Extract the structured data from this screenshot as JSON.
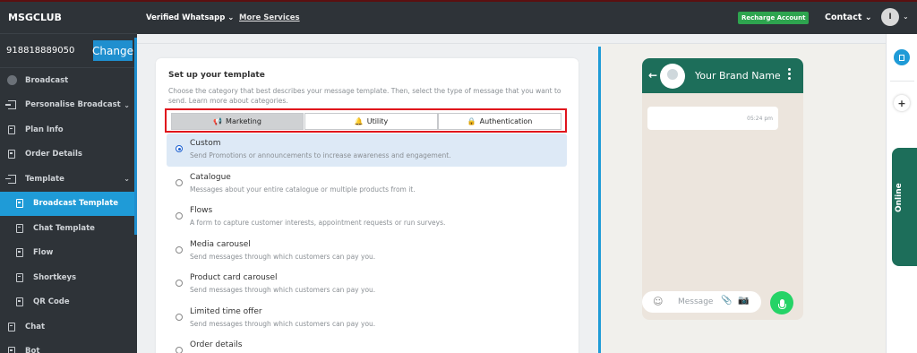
{
  "brand": "MSGCLUB",
  "phone_number": "918818889050",
  "change_label": "Change",
  "sidebar": {
    "items": [
      {
        "label": "Broadcast",
        "icon": "broadcast-icon"
      },
      {
        "label": "Personalise Broadcast",
        "icon": "login-icon",
        "chevron": true
      },
      {
        "label": "Plan Info",
        "icon": "document-icon"
      },
      {
        "label": "Order Details",
        "icon": "document-icon"
      },
      {
        "label": "Template",
        "icon": "login-icon",
        "chevron": true
      },
      {
        "label": "Broadcast Template",
        "icon": "document-icon",
        "sub": true,
        "active": true
      },
      {
        "label": "Chat Template",
        "icon": "document-icon",
        "sub": true
      },
      {
        "label": "Flow",
        "icon": "document-icon",
        "sub": true
      },
      {
        "label": "Shortkeys",
        "icon": "document-icon",
        "sub": true
      },
      {
        "label": "QR Code",
        "icon": "document-icon",
        "sub": true
      },
      {
        "label": "Chat",
        "icon": "document-icon"
      },
      {
        "label": "Bot",
        "icon": "document-icon"
      }
    ]
  },
  "topbar": {
    "channel": "Verified Whatsapp",
    "more_services": "More Services",
    "recharge": "Recharge Account",
    "contact": "Contact",
    "avatar_initial": "I"
  },
  "template_card": {
    "title": "Set up your template",
    "description": "Choose the category that best describes your message template. Then, select the type of message that you want to send. Learn more about categories.",
    "tabs": [
      {
        "label": "Marketing",
        "icon": "megaphone-icon",
        "active": true
      },
      {
        "label": "Utility",
        "icon": "bell-icon",
        "active": false
      },
      {
        "label": "Authentication",
        "icon": "lock-icon",
        "active": false
      }
    ],
    "options": [
      {
        "title": "Custom",
        "desc": "Send Promotions or announcements to increase awareness and engagement.",
        "selected": true
      },
      {
        "title": "Catalogue",
        "desc": "Messages about your entire catalogue or multiple products from it.",
        "selected": false
      },
      {
        "title": "Flows",
        "desc": "A form to capture customer interests, appointment requests or run surveys.",
        "selected": false
      },
      {
        "title": "Media carousel",
        "desc": "Send messages through which customers can pay you.",
        "selected": false
      },
      {
        "title": "Product card carousel",
        "desc": "Send messages through which customers can pay you.",
        "selected": false
      },
      {
        "title": "Limited time offer",
        "desc": "Send messages through which customers can pay you.",
        "selected": false
      },
      {
        "title": "Order details",
        "desc": "",
        "selected": false
      }
    ]
  },
  "preview": {
    "brand_name": "Your Brand Name",
    "time": "05:24 pm",
    "message_placeholder": "Message"
  },
  "rail": {
    "online": "Online"
  },
  "colors": {
    "sidebar_bg": "#2e3338",
    "accent": "#1f9bd7",
    "whatsapp_green": "#1d6e5a",
    "recharge_green": "#2ea44f",
    "highlight_red": "#e0131c",
    "selected_option": "#dde9f6"
  }
}
